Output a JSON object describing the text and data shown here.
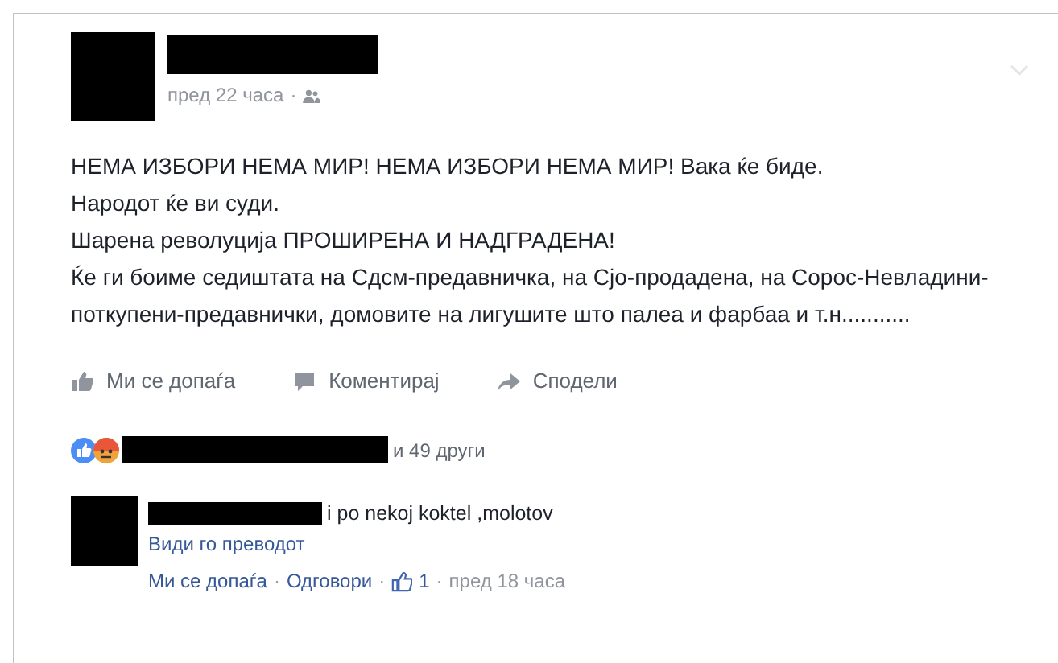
{
  "post": {
    "time": "пред 22 часа",
    "separator": "·",
    "paragraphs": [
      "НЕМА ИЗБОРИ НЕМА МИР! НЕМА ИЗБОРИ НЕМА МИР! Вака ќе биде.",
      "Народот ќе ви суди.",
      "Шарена револуција ПРОШИРЕНА И НАДГРАДЕНА!",
      "Ќе ги боиме седиштата на Сдсм-предавничка, на Сјо-продадена, на Сорос-Невладини-поткупени-предавнички, домовите на лигушите што палеа и фарбаа и т.н..........."
    ]
  },
  "actions": [
    {
      "kind": "like",
      "label": "Ми се допаѓа"
    },
    {
      "kind": "comment",
      "label": "Коментирај"
    },
    {
      "kind": "share",
      "label": "Сподели"
    }
  ],
  "reactions": {
    "others": "и 49 други"
  },
  "comment": {
    "text": "i po nekoj koktel ,molotov",
    "translate": "Види го преводот",
    "like": "Ми се допаѓа",
    "reply": "Одговори",
    "likes": "1",
    "time": "пред 18 часа",
    "sep": "·"
  }
}
